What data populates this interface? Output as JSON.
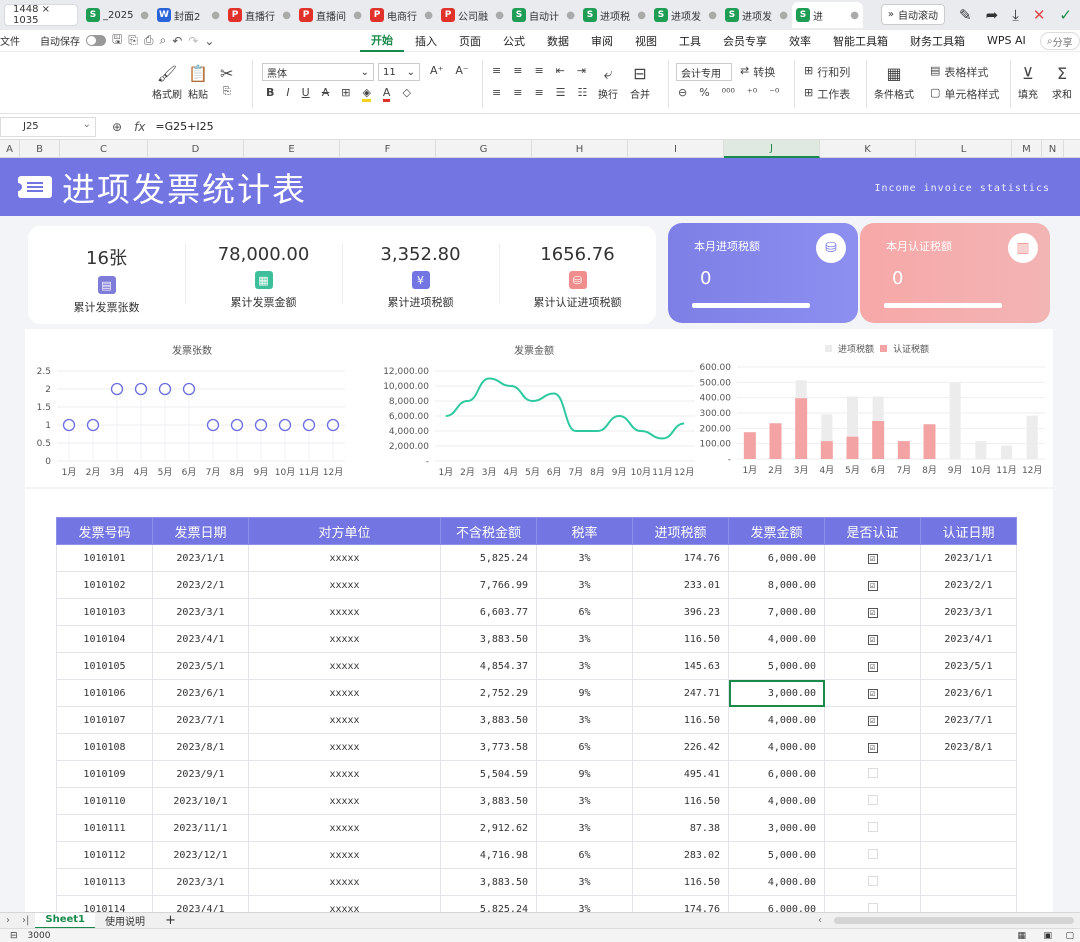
{
  "titlebar": {
    "size_badge": "1448 × 1035",
    "tabs": [
      {
        "icon": "S",
        "kind": "s",
        "label": "_2025"
      },
      {
        "icon": "W",
        "kind": "w",
        "label": "封面2"
      },
      {
        "icon": "P",
        "kind": "p",
        "label": "直播行"
      },
      {
        "icon": "P",
        "kind": "p",
        "label": "直播间"
      },
      {
        "icon": "P",
        "kind": "p",
        "label": "电商行"
      },
      {
        "icon": "P",
        "kind": "p",
        "label": "公司融"
      },
      {
        "icon": "S",
        "kind": "s",
        "label": "自动计"
      },
      {
        "icon": "S",
        "kind": "s",
        "label": "进项税"
      },
      {
        "icon": "S",
        "kind": "s",
        "label": "进项发"
      },
      {
        "icon": "S",
        "kind": "s",
        "label": "进项发票"
      },
      {
        "icon": "S",
        "kind": "s",
        "label": "进"
      }
    ],
    "auto_scroll": "自动滚动"
  },
  "menubar": {
    "file": "文件",
    "autosave": "自动保存",
    "items": [
      "开始",
      "插入",
      "页面",
      "公式",
      "数据",
      "审阅",
      "视图",
      "工具",
      "会员专享",
      "效率",
      "智能工具箱",
      "财务工具箱",
      "WPS AI"
    ],
    "search": "分享"
  },
  "ribbon": {
    "format_painter": "格式刷",
    "paste": "粘贴",
    "font_name": "黑体",
    "font_size": "11",
    "wrap": "换行",
    "merge": "合并",
    "number_format": "会计专用",
    "convert": "转换",
    "row_col": "行和列",
    "worksheet": "工作表",
    "cond_format": "条件格式",
    "table_style": "表格样式",
    "cell_style": "单元格样式",
    "fill": "填充",
    "sum": "求和"
  },
  "formula": {
    "cell_ref": "J25",
    "content": "=G25+I25"
  },
  "columns": [
    "A",
    "B",
    "C",
    "D",
    "E",
    "F",
    "G",
    "H",
    "I",
    "J",
    "K",
    "L",
    "M",
    "N"
  ],
  "banner": {
    "title": "进项发票统计表",
    "subtitle": "Income invoice statistics"
  },
  "kpis": [
    {
      "value": "16张",
      "label": "累计发票张数",
      "icon": "document-icon",
      "color": "#7f7bd8"
    },
    {
      "value": "78,000.00",
      "label": "累计发票金额",
      "icon": "calculator-icon",
      "color": "#3dbf9c"
    },
    {
      "value": "3,352.80",
      "label": "累计进项税额",
      "icon": "yen-icon",
      "color": "#7275e2"
    },
    {
      "value": "1656.76",
      "label": "累计认证进项税额",
      "icon": "coins-icon",
      "color": "#f08d8d"
    }
  ],
  "tax_cards": [
    {
      "label": "本月进项税额",
      "value": "0"
    },
    {
      "label": "本月认证税额",
      "value": "0"
    }
  ],
  "colors": {
    "accent": "#7275e2",
    "green": "#1a8a4a",
    "teal": "#2ec9a0",
    "pink": "#f3a3a3",
    "grey_bar": "#ececec"
  },
  "chart_data": [
    {
      "type": "scatter",
      "title": "发票张数",
      "categories": [
        "1月",
        "2月",
        "3月",
        "4月",
        "5月",
        "6月",
        "7月",
        "8月",
        "9月",
        "10月",
        "11月",
        "12月"
      ],
      "values": [
        1,
        1,
        2,
        2,
        2,
        2,
        1,
        1,
        1,
        1,
        1,
        1
      ],
      "yticks": [
        "2.5",
        "2",
        "1.5",
        "1",
        "0.5",
        "0"
      ],
      "ylim": [
        0,
        2.5
      ]
    },
    {
      "type": "line",
      "title": "发票金额",
      "categories": [
        "1月",
        "2月",
        "3月",
        "4月",
        "5月",
        "6月",
        "7月",
        "8月",
        "9月",
        "10月",
        "11月",
        "12月"
      ],
      "values": [
        6000,
        8000,
        11000,
        10000,
        8000,
        9000,
        4000,
        4000,
        6000,
        4000,
        3000,
        5000
      ],
      "yticks": [
        "12,000.00",
        "10,000.00",
        "8,000.00",
        "6,000.00",
        "4,000.00",
        "2,000.00",
        "-"
      ],
      "ylim": [
        0,
        12000
      ]
    },
    {
      "type": "bar",
      "categories": [
        "1月",
        "2月",
        "3月",
        "4月",
        "5月",
        "6月",
        "7月",
        "8月",
        "9月",
        "10月",
        "11月",
        "12月"
      ],
      "series": [
        {
          "name": "进项税额",
          "values": [
            174.76,
            233.01,
            513.59,
            291.26,
            407.77,
            407.77,
            116.5,
            226.42,
            495.41,
            116.5,
            87.38,
            283.02
          ]
        },
        {
          "name": "认证税额",
          "values": [
            174.76,
            233.01,
            396.23,
            116.5,
            145.63,
            247.71,
            116.5,
            226.42,
            0,
            0,
            0,
            0
          ]
        }
      ],
      "yticks": [
        "600.00",
        "500.00",
        "400.00",
        "300.00",
        "200.00",
        "100.00",
        "-"
      ],
      "ylim": [
        0,
        600
      ],
      "legend": "top-center"
    }
  ],
  "table": {
    "headers": [
      "发票号码",
      "发票日期",
      "对方单位",
      "不含税金额",
      "税率",
      "进项税额",
      "发票金额",
      "是否认证",
      "认证日期"
    ],
    "rows": [
      [
        "1010101",
        "2023/1/1",
        "xxxxx",
        "5,825.24",
        "3%",
        "174.76",
        "6,000.00",
        "☑",
        "2023/1/1"
      ],
      [
        "1010102",
        "2023/2/1",
        "xxxxx",
        "7,766.99",
        "3%",
        "233.01",
        "8,000.00",
        "☑",
        "2023/2/1"
      ],
      [
        "1010103",
        "2023/3/1",
        "xxxxx",
        "6,603.77",
        "6%",
        "396.23",
        "7,000.00",
        "☑",
        "2023/3/1"
      ],
      [
        "1010104",
        "2023/4/1",
        "xxxxx",
        "3,883.50",
        "3%",
        "116.50",
        "4,000.00",
        "☑",
        "2023/4/1"
      ],
      [
        "1010105",
        "2023/5/1",
        "xxxxx",
        "4,854.37",
        "3%",
        "145.63",
        "5,000.00",
        "☑",
        "2023/5/1"
      ],
      [
        "1010106",
        "2023/6/1",
        "xxxxx",
        "2,752.29",
        "9%",
        "247.71",
        "3,000.00",
        "☑",
        "2023/6/1"
      ],
      [
        "1010107",
        "2023/7/1",
        "xxxxx",
        "3,883.50",
        "3%",
        "116.50",
        "4,000.00",
        "☑",
        "2023/7/1"
      ],
      [
        "1010108",
        "2023/8/1",
        "xxxxx",
        "3,773.58",
        "6%",
        "226.42",
        "4,000.00",
        "☑",
        "2023/8/1"
      ],
      [
        "1010109",
        "2023/9/1",
        "xxxxx",
        "5,504.59",
        "9%",
        "495.41",
        "6,000.00",
        "",
        ""
      ],
      [
        "1010110",
        "2023/10/1",
        "xxxxx",
        "3,883.50",
        "3%",
        "116.50",
        "4,000.00",
        "",
        ""
      ],
      [
        "1010111",
        "2023/11/1",
        "xxxxx",
        "2,912.62",
        "3%",
        "87.38",
        "3,000.00",
        "",
        ""
      ],
      [
        "1010112",
        "2023/12/1",
        "xxxxx",
        "4,716.98",
        "6%",
        "283.02",
        "5,000.00",
        "",
        ""
      ],
      [
        "1010113",
        "2023/3/1",
        "xxxxx",
        "3,883.50",
        "3%",
        "116.50",
        "4,000.00",
        "",
        ""
      ],
      [
        "1010114",
        "2023/4/1",
        "xxxxx",
        "5,825.24",
        "3%",
        "174.76",
        "6,000.00",
        "",
        ""
      ]
    ]
  },
  "sheet_tabs": [
    "Sheet1",
    "使用说明"
  ],
  "status": {
    "value": "3000"
  }
}
